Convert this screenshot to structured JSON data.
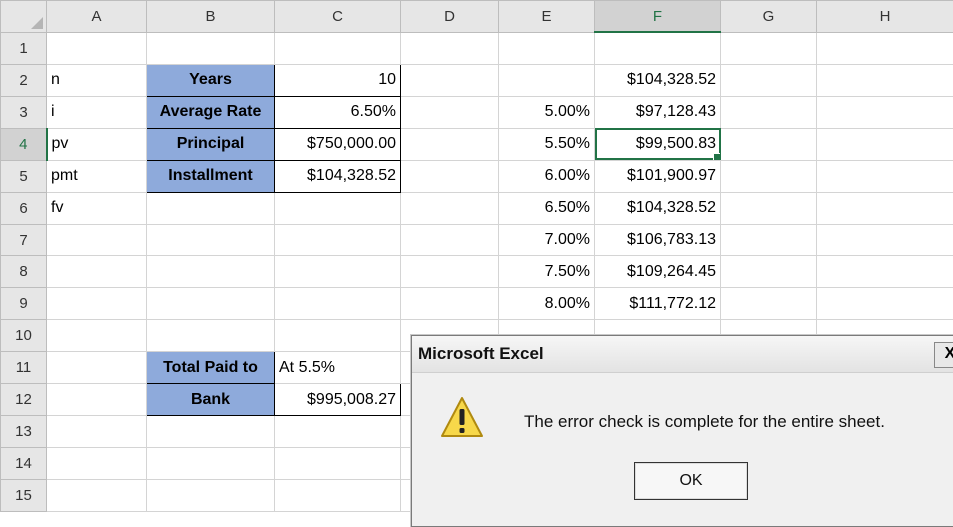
{
  "columns": [
    "A",
    "B",
    "C",
    "D",
    "E",
    "F",
    "G",
    "H"
  ],
  "rows": [
    "1",
    "2",
    "3",
    "4",
    "5",
    "6",
    "7",
    "8",
    "9",
    "10",
    "11",
    "12",
    "13",
    "14",
    "15"
  ],
  "cells": {
    "A2": "n",
    "A3": "i",
    "A4": "pv",
    "A5": "pmt",
    "A6": "fv",
    "B2": "Years",
    "B3": "Average Rate",
    "B4": "Principal",
    "B5": "Installment",
    "B11": "Total Paid to",
    "B12": "Bank",
    "C2": "10",
    "C3": "6.50%",
    "C4": "$750,000.00",
    "C5": "$104,328.52",
    "C11": "At 5.5%",
    "C12": "$995,008.27",
    "E3": "5.00%",
    "E4": "5.50%",
    "E5": "6.00%",
    "E6": "6.50%",
    "E7": "7.00%",
    "E8": "7.50%",
    "E9": "8.00%",
    "F2": "$104,328.52",
    "F3": "$97,128.43",
    "F4": "$99,500.83",
    "F5": "$101,900.97",
    "F6": "$104,328.52",
    "F7": "$106,783.13",
    "F8": "$109,264.45",
    "F9": "$111,772.12"
  },
  "active_cell": "F4",
  "label_fill_color": "#8eaadb",
  "dialog": {
    "title": "Microsoft Excel",
    "close": "X",
    "icon": "warning-icon",
    "message": "The error check is complete for the entire sheet.",
    "ok": "OK"
  }
}
